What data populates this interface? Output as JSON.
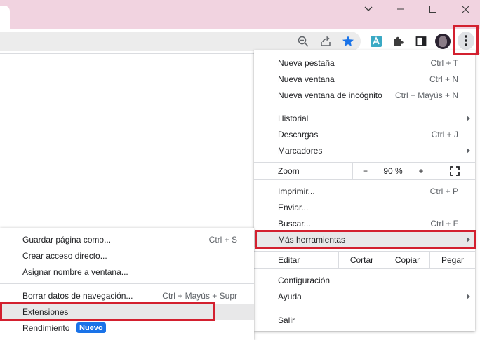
{
  "colors": {
    "titlebar": "#f1d3e0",
    "accent": "#1a73e8",
    "highlight": "#d3202f",
    "hover": "#e8e8e9"
  },
  "window_controls": [
    "chevron-down-icon",
    "minimize-icon",
    "maximize-icon",
    "close-icon"
  ],
  "toolbar": {
    "icons": [
      "zoom-icon",
      "share-icon",
      "bookmark-star-icon",
      "extension-app-icon",
      "puzzle-icon",
      "side-panel-icon",
      "profile-avatar",
      "kebab-menu-icon"
    ]
  },
  "main_menu": {
    "items": [
      {
        "label": "Nueva pestaña",
        "shortcut": "Ctrl + T"
      },
      {
        "label": "Nueva ventana",
        "shortcut": "Ctrl + N"
      },
      {
        "label": "Nueva ventana de incógnito",
        "shortcut": "Ctrl + Mayús + N"
      },
      {
        "label": "Historial",
        "shortcut": ""
      },
      {
        "label": "Descargas",
        "shortcut": "Ctrl + J"
      },
      {
        "label": "Marcadores",
        "shortcut": ""
      },
      {
        "label": "Imprimir...",
        "shortcut": "Ctrl + P"
      },
      {
        "label": "Enviar...",
        "shortcut": ""
      },
      {
        "label": "Buscar...",
        "shortcut": "Ctrl + F"
      },
      {
        "label": "Más herramientas",
        "shortcut": ""
      },
      {
        "label": "Configuración",
        "shortcut": ""
      },
      {
        "label": "Ayuda",
        "shortcut": ""
      },
      {
        "label": "Salir",
        "shortcut": ""
      }
    ],
    "zoom": {
      "label": "Zoom",
      "minus": "−",
      "value": "90 %",
      "plus": "+"
    },
    "edit": {
      "label": "Editar",
      "cut": "Cortar",
      "copy": "Copiar",
      "paste": "Pegar"
    }
  },
  "sub_menu": {
    "items": [
      {
        "label": "Guardar página como...",
        "shortcut": "Ctrl + S"
      },
      {
        "label": "Crear acceso directo...",
        "shortcut": ""
      },
      {
        "label": "Asignar nombre a ventana...",
        "shortcut": ""
      },
      {
        "label": "Borrar datos de navegación...",
        "shortcut": "Ctrl + Mayús + Supr"
      },
      {
        "label": "Extensiones",
        "shortcut": ""
      },
      {
        "label": "Rendimiento",
        "shortcut": "",
        "badge": "Nuevo"
      }
    ]
  }
}
